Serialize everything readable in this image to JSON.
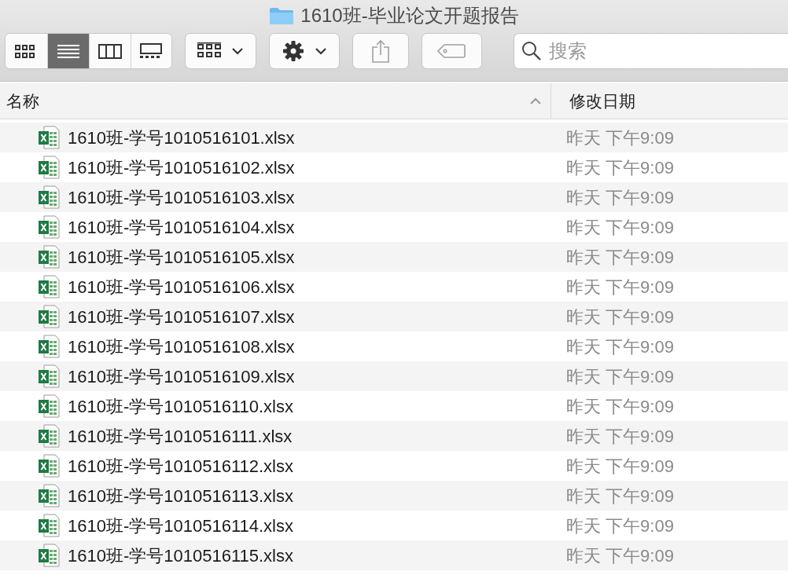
{
  "window": {
    "title": "1610班-毕业论文开题报告"
  },
  "toolbar": {
    "view_modes": [
      {
        "kind": "icons",
        "selected": false
      },
      {
        "kind": "list",
        "selected": true
      },
      {
        "kind": "columns",
        "selected": false
      },
      {
        "kind": "gallery",
        "selected": false
      }
    ],
    "search": {
      "placeholder": "搜索"
    }
  },
  "table": {
    "columns": [
      {
        "label": "名称",
        "sorted": true
      },
      {
        "label": "修改日期",
        "sorted": false
      }
    ],
    "rows": [
      {
        "name": "1610班-学号1010516101.xlsx",
        "date": "昨天 下午9:09"
      },
      {
        "name": "1610班-学号1010516102.xlsx",
        "date": "昨天 下午9:09"
      },
      {
        "name": "1610班-学号1010516103.xlsx",
        "date": "昨天 下午9:09"
      },
      {
        "name": "1610班-学号1010516104.xlsx",
        "date": "昨天 下午9:09"
      },
      {
        "name": "1610班-学号1010516105.xlsx",
        "date": "昨天 下午9:09"
      },
      {
        "name": "1610班-学号1010516106.xlsx",
        "date": "昨天 下午9:09"
      },
      {
        "name": "1610班-学号1010516107.xlsx",
        "date": "昨天 下午9:09"
      },
      {
        "name": "1610班-学号1010516108.xlsx",
        "date": "昨天 下午9:09"
      },
      {
        "name": "1610班-学号1010516109.xlsx",
        "date": "昨天 下午9:09"
      },
      {
        "name": "1610班-学号1010516110.xlsx",
        "date": "昨天 下午9:09"
      },
      {
        "name": "1610班-学号1010516111.xlsx",
        "date": "昨天 下午9:09"
      },
      {
        "name": "1610班-学号1010516112.xlsx",
        "date": "昨天 下午9:09"
      },
      {
        "name": "1610班-学号1010516113.xlsx",
        "date": "昨天 下午9:09"
      },
      {
        "name": "1610班-学号1010516114.xlsx",
        "date": "昨天 下午9:09"
      },
      {
        "name": "1610班-学号1010516115.xlsx",
        "date": "昨天 下午9:09"
      }
    ]
  }
}
